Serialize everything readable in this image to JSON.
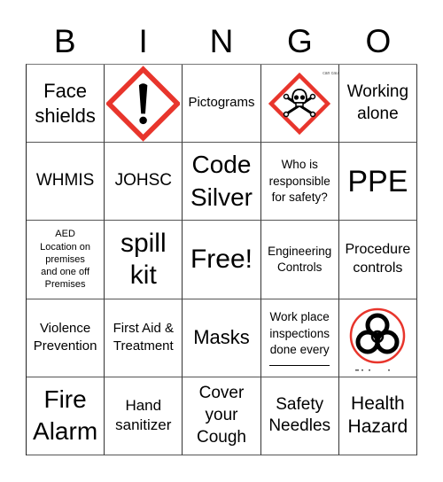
{
  "header": {
    "letters": [
      "B",
      "I",
      "N",
      "G",
      "O"
    ]
  },
  "cells": [
    {
      "text": "Face\nshields"
    },
    {
      "icon": "exclamation-hazard-pictogram"
    },
    {
      "text": "Pictograms"
    },
    {
      "icon": "skull-crossbones-pictogram",
      "caption": "can cau"
    },
    {
      "text": "Working\nalone"
    },
    {
      "text": "WHMIS"
    },
    {
      "text": "JOHSC"
    },
    {
      "text": "Code\nSilver"
    },
    {
      "text": "Who is\nresponsible\nfor safety?"
    },
    {
      "text": "PPE"
    },
    {
      "text": "AED\nLocation on\npremises\nand one off\nPremises"
    },
    {
      "text": "spill\nkit"
    },
    {
      "text": "Free!"
    },
    {
      "text": "Engineering\nControls"
    },
    {
      "text": "Procedure\ncontrols"
    },
    {
      "text": "Violence\nPrevention"
    },
    {
      "text": "First Aid &\nTreatment"
    },
    {
      "text": "Masks"
    },
    {
      "text": "Work place\ninspections\ndone every"
    },
    {
      "icon": "biohazard-symbol"
    },
    {
      "text": "Fire\nAlarm"
    },
    {
      "text": "Hand\nsanitizer"
    },
    {
      "text": "Cover\nyour\nCough"
    },
    {
      "text": "Safety\nNeedles"
    },
    {
      "text": "Health\nHazard"
    }
  ],
  "colors": {
    "pictogram_red": "#e8352c",
    "border": "#333333"
  }
}
